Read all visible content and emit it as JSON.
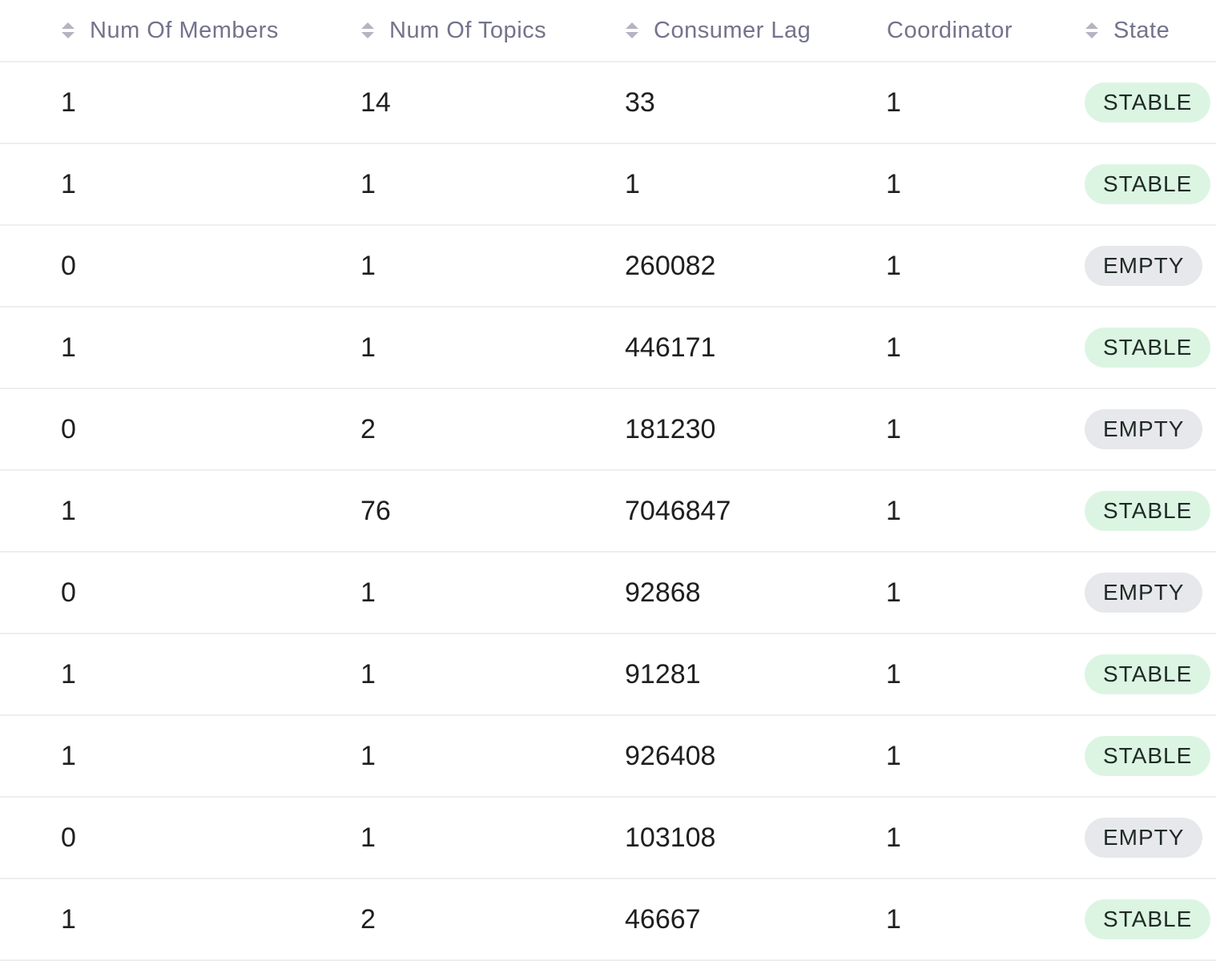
{
  "columns": {
    "members": "Num Of Members",
    "topics": "Num Of Topics",
    "lag": "Consumer Lag",
    "coordinator": "Coordinator",
    "state": "State"
  },
  "icons": {
    "sort": "sort-icon"
  },
  "colors": {
    "stable_badge_bg": "#dcf5e3",
    "empty_badge_bg": "#e7e8ec",
    "header_text": "#73738c"
  },
  "rows": [
    {
      "members": "1",
      "topics": "14",
      "lag": "33",
      "coordinator": "1",
      "state": "STABLE"
    },
    {
      "members": "1",
      "topics": "1",
      "lag": "1",
      "coordinator": "1",
      "state": "STABLE"
    },
    {
      "members": "0",
      "topics": "1",
      "lag": "260082",
      "coordinator": "1",
      "state": "EMPTY"
    },
    {
      "members": "1",
      "topics": "1",
      "lag": "446171",
      "coordinator": "1",
      "state": "STABLE"
    },
    {
      "members": "0",
      "topics": "2",
      "lag": "181230",
      "coordinator": "1",
      "state": "EMPTY"
    },
    {
      "members": "1",
      "topics": "76",
      "lag": "7046847",
      "coordinator": "1",
      "state": "STABLE"
    },
    {
      "members": "0",
      "topics": "1",
      "lag": "92868",
      "coordinator": "1",
      "state": "EMPTY"
    },
    {
      "members": "1",
      "topics": "1",
      "lag": "91281",
      "coordinator": "1",
      "state": "STABLE"
    },
    {
      "members": "1",
      "topics": "1",
      "lag": "926408",
      "coordinator": "1",
      "state": "STABLE"
    },
    {
      "members": "0",
      "topics": "1",
      "lag": "103108",
      "coordinator": "1",
      "state": "EMPTY"
    },
    {
      "members": "1",
      "topics": "2",
      "lag": "46667",
      "coordinator": "1",
      "state": "STABLE"
    }
  ]
}
